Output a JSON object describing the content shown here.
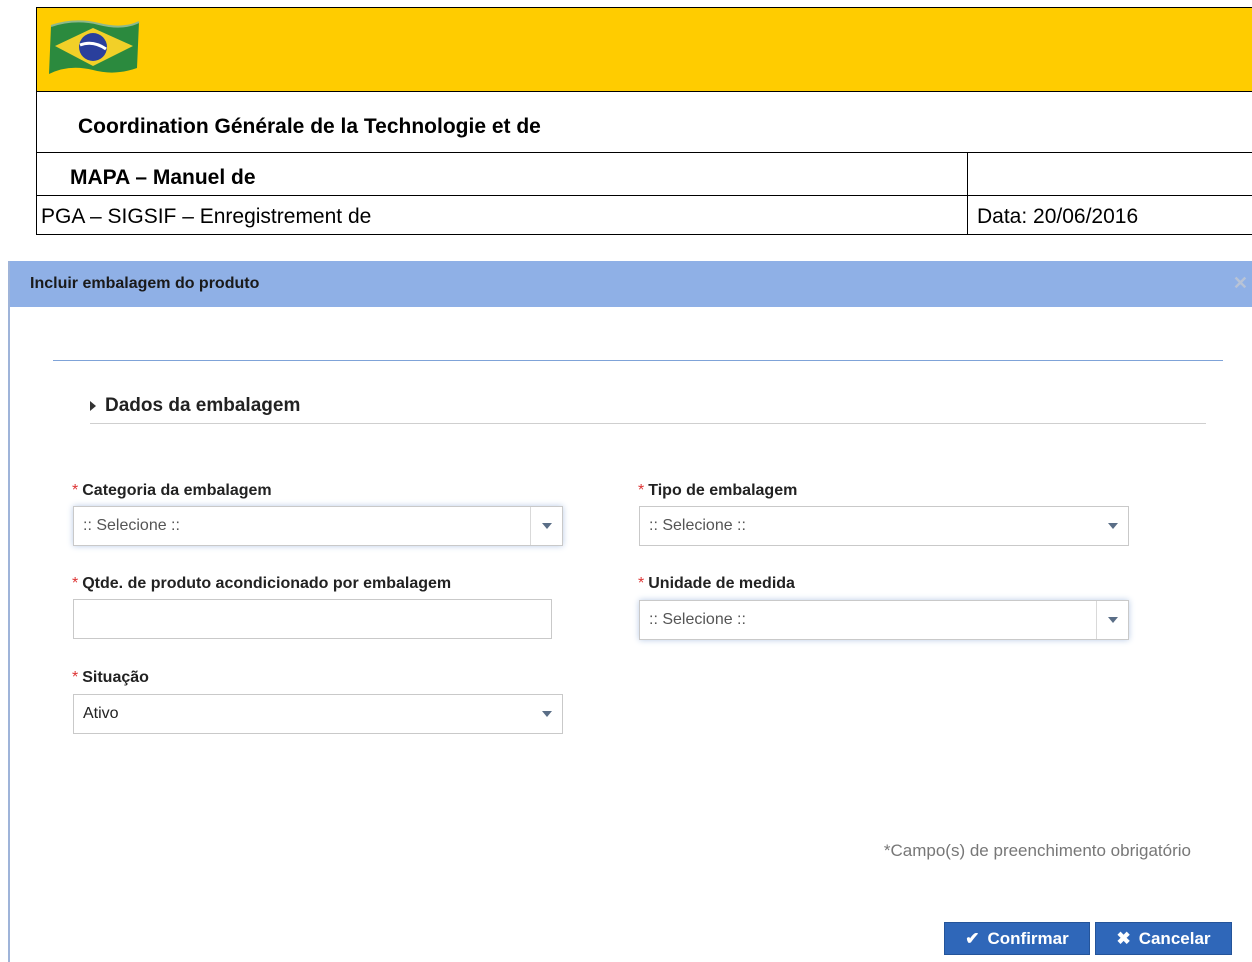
{
  "document": {
    "heading": "Coordination Générale de la Technologie et de",
    "manual_title": "MAPA – Manuel de",
    "subtitle": "PGA – SIGSIF – Enregistrement de",
    "date": "Data: 20/06/2016",
    "banner_color": "#ffcc00"
  },
  "modal": {
    "title": "Incluir embalagem do produto",
    "close_icon": "close-icon",
    "header_color": "#8fb0e6",
    "section_title": "Dados da embalagem",
    "required_marker": "*",
    "fields": {
      "categoria": {
        "label": "Categoria da embalagem",
        "value": ":: Selecione ::"
      },
      "tipo": {
        "label": "Tipo de embalagem",
        "value": ":: Selecione ::"
      },
      "quantidade": {
        "label": "Qtde. de produto acondicionado por embalagem",
        "value": ""
      },
      "unidade": {
        "label": "Unidade de medida",
        "value": ":: Selecione ::"
      },
      "situacao": {
        "label": "Situação",
        "value": "Ativo"
      }
    },
    "required_note": "*Campo(s) de preenchimento obrigatório",
    "buttons": {
      "confirm": "Confirmar",
      "cancel": "Cancelar"
    },
    "accent_color": "#2f67b9"
  }
}
